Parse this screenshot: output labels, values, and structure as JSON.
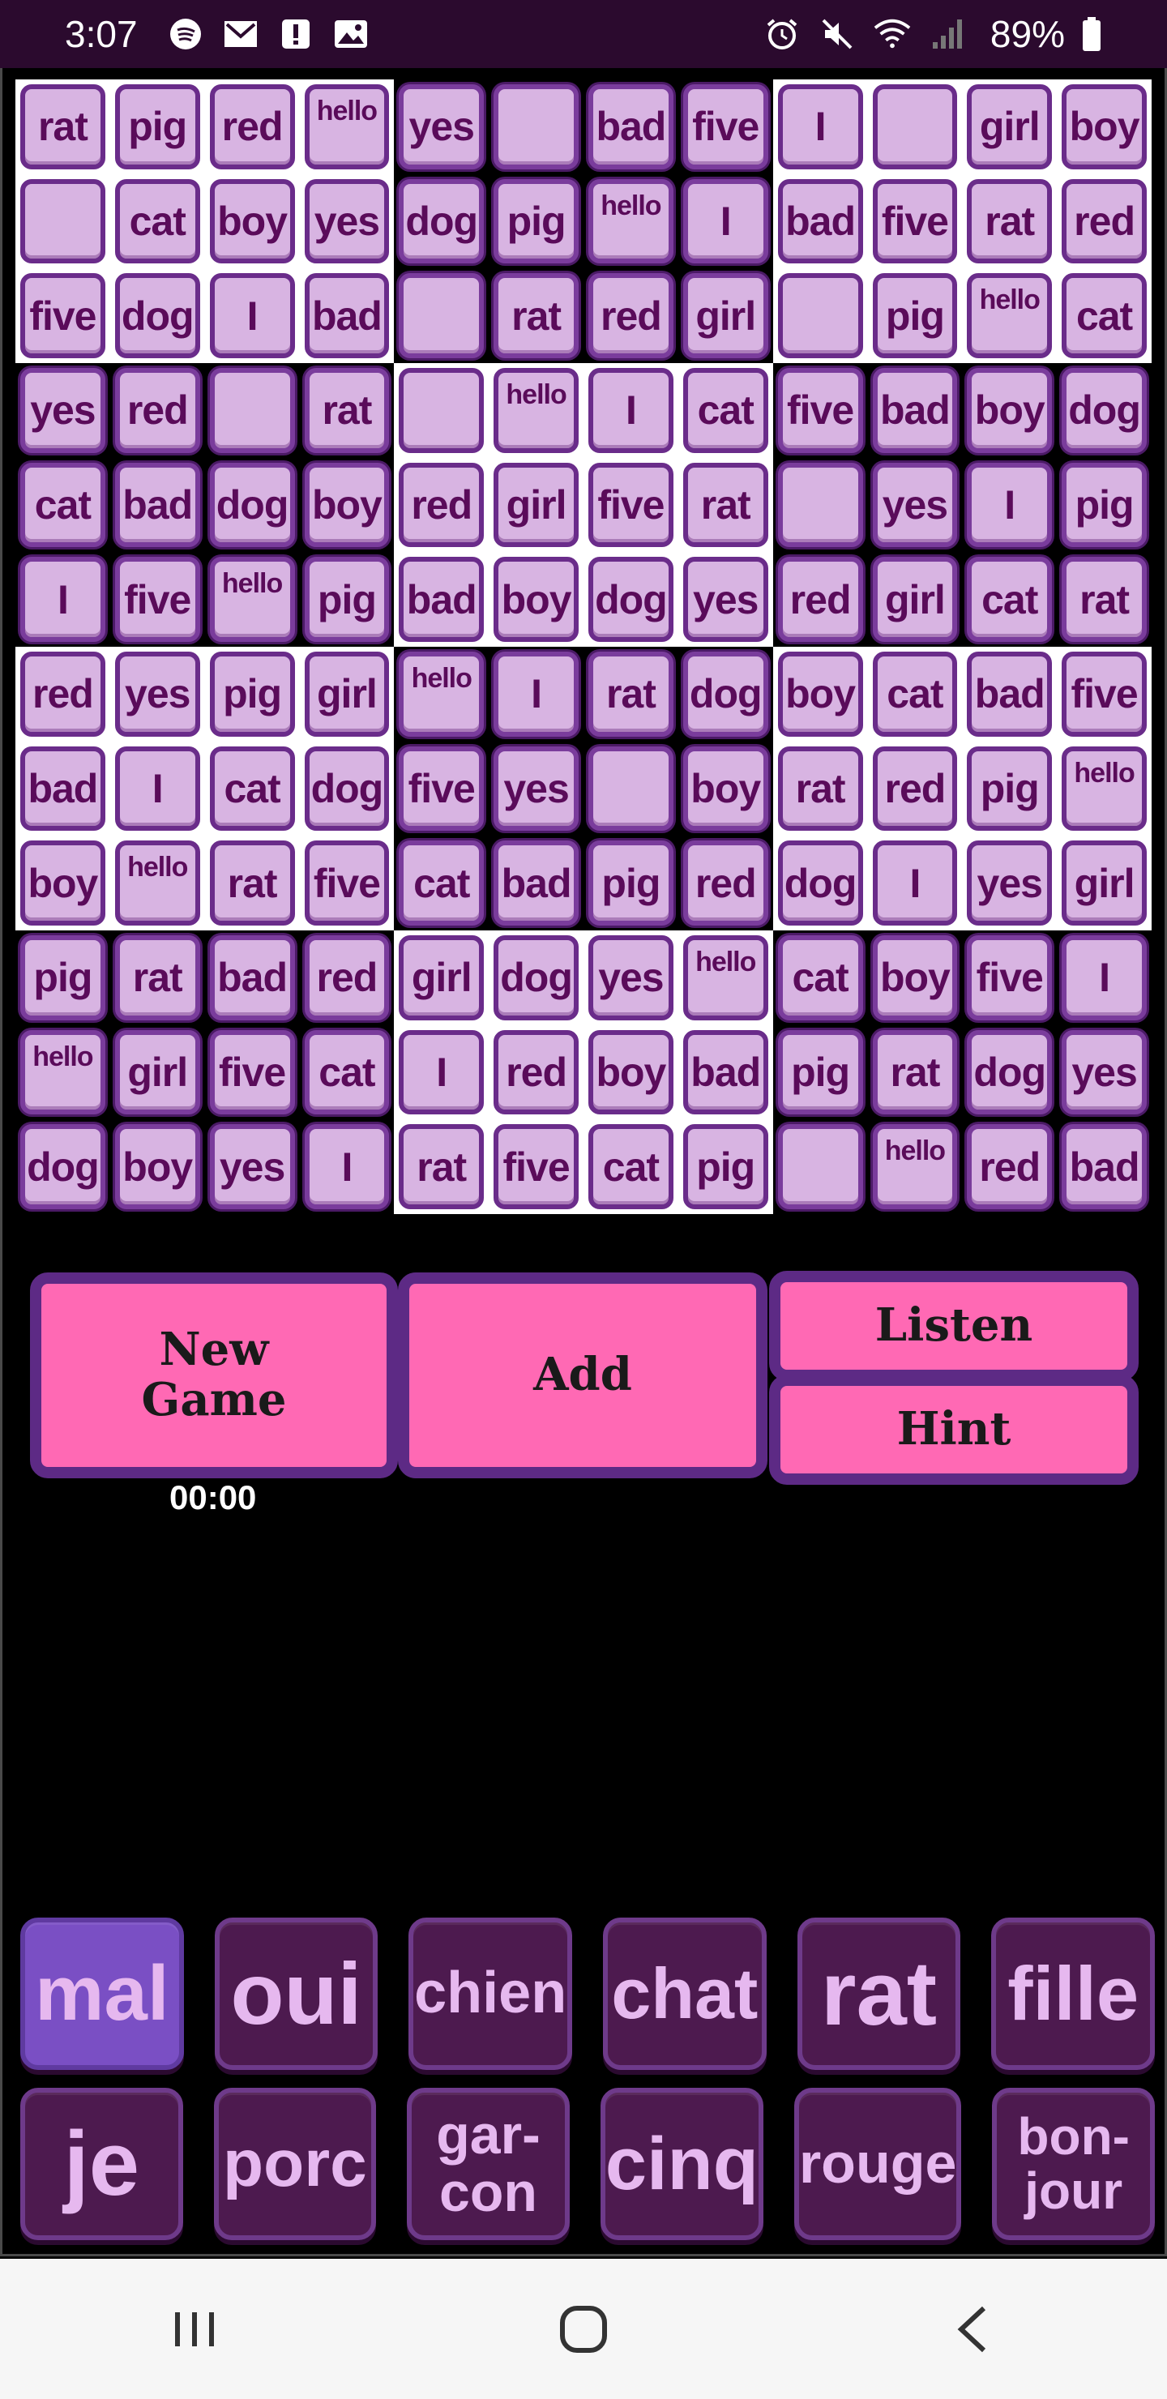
{
  "status_bar": {
    "time": "3:07",
    "battery": "89%",
    "icons": [
      "spotify-icon",
      "gmail-icon",
      "alert-icon",
      "image-icon",
      "alarm-icon",
      "mute-icon",
      "wifi-icon",
      "signal-icon",
      "battery-icon"
    ]
  },
  "grid": {
    "rows": [
      [
        "rat",
        "pig",
        "red",
        "hello",
        "yes",
        "",
        "bad",
        "five",
        "I",
        "",
        "girl",
        "boy"
      ],
      [
        "",
        "cat",
        "boy",
        "yes",
        "dog",
        "pig",
        "hello",
        "I",
        "bad",
        "five",
        "rat",
        "red"
      ],
      [
        "five",
        "dog",
        "I",
        "bad",
        "",
        "rat",
        "red",
        "girl",
        "",
        "pig",
        "hello",
        "cat"
      ],
      [
        "yes",
        "red",
        "",
        "rat",
        "",
        "hello",
        "I",
        "cat",
        "five",
        "bad",
        "boy",
        "dog"
      ],
      [
        "cat",
        "bad",
        "dog",
        "boy",
        "red",
        "girl",
        "five",
        "rat",
        "",
        "yes",
        "I",
        "pig"
      ],
      [
        "I",
        "five",
        "hello",
        "pig",
        "bad",
        "boy",
        "dog",
        "yes",
        "red",
        "girl",
        "cat",
        "rat"
      ],
      [
        "red",
        "yes",
        "pig",
        "girl",
        "hello",
        "I",
        "rat",
        "dog",
        "boy",
        "cat",
        "bad",
        "five"
      ],
      [
        "bad",
        "I",
        "cat",
        "dog",
        "five",
        "yes",
        "",
        "boy",
        "rat",
        "red",
        "pig",
        "hello"
      ],
      [
        "boy",
        "hello",
        "rat",
        "five",
        "cat",
        "bad",
        "pig",
        "red",
        "dog",
        "I",
        "yes",
        "girl"
      ],
      [
        "pig",
        "rat",
        "bad",
        "red",
        "girl",
        "dog",
        "yes",
        "hello",
        "cat",
        "boy",
        "five",
        "I"
      ],
      [
        "hello",
        "girl",
        "five",
        "cat",
        "I",
        "red",
        "boy",
        "bad",
        "pig",
        "rat",
        "dog",
        "yes"
      ],
      [
        "dog",
        "boy",
        "yes",
        "I",
        "rat",
        "five",
        "cat",
        "pig",
        "",
        "hello",
        "red",
        "bad"
      ]
    ]
  },
  "buttons": {
    "new_game": "New Game",
    "add": "Add",
    "listen": "Listen",
    "hint": "Hint"
  },
  "timer": "00:00",
  "word_bank": {
    "row1": [
      "mal",
      "oui",
      "chien",
      "chat",
      "rat",
      "fille"
    ],
    "row2": [
      "je",
      "porc",
      "gar-con",
      "cinq",
      "rouge",
      "bon-jour"
    ],
    "selected": "mal"
  },
  "colors": {
    "tile_fill": "#d8b4e2",
    "tile_border": "#6a2c8a",
    "tile_text": "#5a0b5a",
    "button_pink": "#ff69b4",
    "button_border": "#5d2a85",
    "bank_tile": "#4d1a4f",
    "bank_selected": "#7a4fc4",
    "bank_text": "#e6b8ef"
  },
  "nav_bar": [
    "recent-apps-icon",
    "home-icon",
    "back-icon"
  ]
}
